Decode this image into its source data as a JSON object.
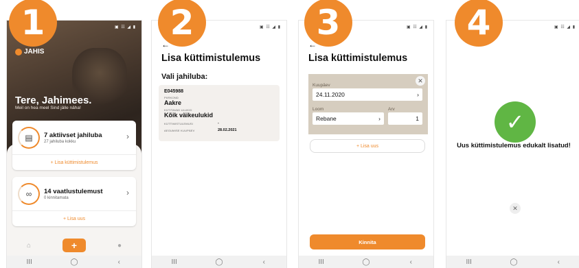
{
  "steps": [
    "1",
    "2",
    "3",
    "4"
  ],
  "status_icons": "▣ ☷ ◢ ▮",
  "nav_buttons": [
    "III",
    "◯",
    "‹"
  ],
  "screen1": {
    "brand": "JAHIS",
    "greeting": "Tere, Jahimees.",
    "greeting_sub": "Meil on hea meel Sind jälle näha!",
    "cards": [
      {
        "title": "7 aktiivset jahiluba",
        "subtitle": "27 jahiluba kokku",
        "action": "+ Lisa küttimistulemus",
        "icon": "permit-card-icon"
      },
      {
        "title": "14 vaatlustulemust",
        "subtitle": "0 kinnitamata",
        "action": "+ Lisa uus",
        "icon": "binoculars-icon"
      }
    ],
    "tabbar": {
      "add": "+"
    }
  },
  "screen2": {
    "title": "Lisa küttimistulemus",
    "subtitle": "Vali jahiluba:",
    "permit": {
      "id": "E045988",
      "area_label": "PIIRKOND",
      "area": "Aakre",
      "species_label": "KÜTITAVAD ULUKID",
      "species": "Kõik väikeulukid",
      "result_label": "KÜTTIMISTULEMUSI",
      "result_value": "-",
      "expiry_label": "AEGUMISE KUUPÄEV",
      "expiry_value": "28.02.2021"
    }
  },
  "screen3": {
    "title": "Lisa küttimistulemus",
    "date_label": "Kuupäev",
    "date_value": "24.11.2020",
    "animal_label": "Loom",
    "animal_value": "Rebane",
    "count_label": "Arv",
    "count_value": "1",
    "add_more": "+ Lisa uus",
    "confirm": "Kinnita"
  },
  "screen4": {
    "message": "Uus küttimistulemus edukalt lisatud!"
  },
  "colors": {
    "accent": "#ef8a2c",
    "success": "#60b644"
  }
}
